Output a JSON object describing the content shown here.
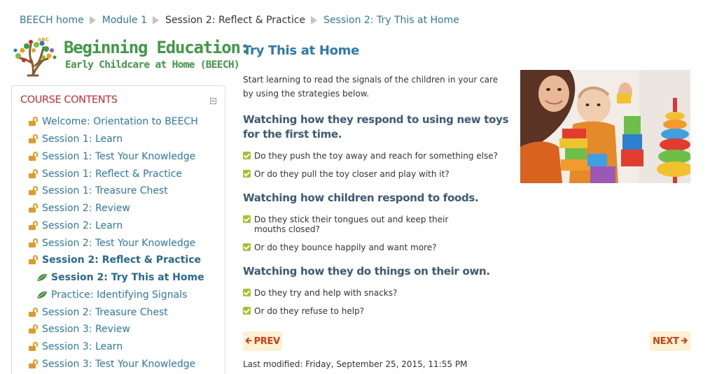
{
  "breadcrumb": {
    "home": "BEECH home",
    "module": "Module 1",
    "section": "Session 2: Reflect & Practice",
    "page": "Session 2: Try This at Home"
  },
  "logo": {
    "badge": "ABC",
    "title": "Beginning Education:",
    "subtitle": "Early Childcare at Home (BEECH)"
  },
  "contents": {
    "title": "COURSE CONTENTS",
    "items": [
      {
        "label": "Welcome: Orientation to BEECH",
        "icon": "lock-open-icon"
      },
      {
        "label": "Session 1: Learn",
        "icon": "lock-open-icon"
      },
      {
        "label": "Session 1: Test Your Knowledge",
        "icon": "lock-open-icon"
      },
      {
        "label": "Session 1: Reflect & Practice",
        "icon": "lock-open-icon"
      },
      {
        "label": "Session 1: Treasure Chest",
        "icon": "lock-open-icon"
      },
      {
        "label": "Session 2: Review",
        "icon": "lock-open-icon"
      },
      {
        "label": "Session 2: Learn",
        "icon": "lock-open-icon"
      },
      {
        "label": "Session 2: Test Your Knowledge",
        "icon": "lock-open-icon"
      },
      {
        "label": "Session 2: Reflect & Practice",
        "icon": "lock-open-icon"
      },
      {
        "label": "Session 2: Try This at Home",
        "icon": "leaf-icon"
      },
      {
        "label": "Practice: Identifying Signals",
        "icon": "leaf-icon"
      },
      {
        "label": "Session 2: Treasure Chest",
        "icon": "lock-open-icon"
      },
      {
        "label": "Session 3: Review",
        "icon": "lock-open-icon"
      },
      {
        "label": "Session 3: Learn",
        "icon": "lock-open-icon"
      },
      {
        "label": "Session 3: Test Your Knowledge",
        "icon": "lock-open-icon"
      }
    ]
  },
  "main": {
    "title": "Try This at Home",
    "intro": "Start learning to read the signals of the children in your care by using the strategies below.",
    "sections": [
      {
        "heading": "Watching how they respond to using new toys for the first time.",
        "items": [
          "Do they push the toy away and reach for something else?",
          "Or do they pull the toy closer and play with it?"
        ]
      },
      {
        "heading": "Watching how children respond to foods.",
        "items": [
          "Do they stick their tongues out and keep their mouths closed?",
          "Or do they bounce happily and want more?"
        ]
      },
      {
        "heading": "Watching how they do things on their own.",
        "items": [
          "Do they try and help with snacks?",
          "Or do they refuse to help?"
        ]
      }
    ]
  },
  "pager": {
    "prev": "PREV",
    "next": "NEXT"
  },
  "footer": {
    "last_modified": "Last modified: Friday, September 25, 2015, 11:55 PM"
  },
  "colors": {
    "link": "#2a7ab0",
    "accent_red": "#d6282b",
    "logo_green": "#3e9a45",
    "lock_orange": "#e39a1f",
    "check_green": "#a6c22b",
    "pager_bg": "#fdf0d3"
  }
}
